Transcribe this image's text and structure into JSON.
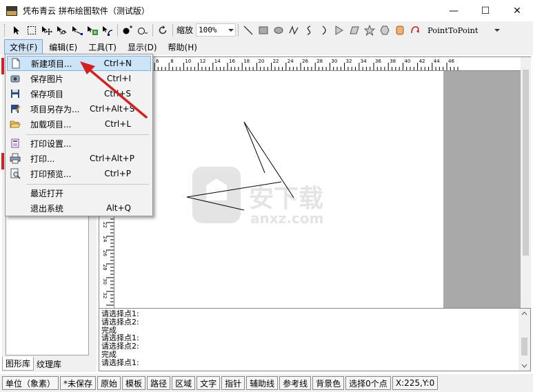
{
  "window": {
    "title": "凭布青云 拼布绘图软件（测试版）",
    "minimize": "—",
    "maximize": "☐",
    "close": "✕"
  },
  "toolbar": {
    "zoom_label": "缩放",
    "zoom_value": "100%",
    "shape_value": "PointToPoint"
  },
  "menubar": {
    "items": [
      "文件(F)",
      "编辑(E)",
      "工具(T)",
      "显示(D)",
      "帮助(H)"
    ],
    "active": "文件(F)"
  },
  "file_menu": {
    "items": [
      {
        "label": "新建项目...",
        "shortcut": "Ctrl+N",
        "icon": "new-file-icon"
      },
      {
        "label": "保存图片",
        "shortcut": "Ctrl+I",
        "icon": "save-image-icon"
      },
      {
        "label": "保存项目",
        "shortcut": "Ctrl+S",
        "icon": "floppy-icon"
      },
      {
        "label": "项目另存为...",
        "shortcut": "Ctrl+Alt+S",
        "icon": "save-as-icon"
      },
      {
        "label": "加载项目...",
        "shortcut": "Ctrl+L",
        "icon": "folder-open-icon"
      },
      {
        "label": "打印设置...",
        "shortcut": "",
        "icon": "print-setup-icon"
      },
      {
        "label": "打印...",
        "shortcut": "Ctrl+Alt+P",
        "icon": "printer-icon"
      },
      {
        "label": "打印预览...",
        "shortcut": "Ctrl+P",
        "icon": "print-preview-icon"
      },
      {
        "label": "最近打开",
        "shortcut": "",
        "icon": ""
      },
      {
        "label": "退出系统",
        "shortcut": "Alt+Q",
        "icon": ""
      }
    ]
  },
  "left_panel": {
    "tabs": [
      "图形库",
      "纹理库"
    ],
    "selected_tab": "图形库"
  },
  "ruler": {
    "top_labels": [
      "6",
      "8",
      "10",
      "12",
      "14",
      "16",
      "18",
      "20",
      "22",
      "24",
      "26",
      "28",
      "30",
      "32",
      "34",
      "36",
      "38",
      "40",
      "42",
      "44",
      "46"
    ],
    "left_labels": [
      "22",
      "24",
      "26",
      "28",
      "30",
      "32"
    ]
  },
  "log": {
    "lines": [
      "请选择点1:",
      "请选择点2:",
      "完成",
      "请选择点1:",
      "请选择点2:",
      "完成",
      "请选择点1:"
    ]
  },
  "statusbar": {
    "cells": [
      "单位（象素）",
      "*未保存",
      "原始",
      "模板",
      "路径",
      "区域",
      "文字",
      "指针",
      "辅助线",
      "参考线",
      "背景色",
      "选择0个点",
      "X:225,Y:0"
    ]
  },
  "watermark": {
    "text_cn": "安下载",
    "text_url": "anxz.com"
  },
  "colors": {
    "accent_arrow": "#d42020",
    "highlight": "#cce4f7",
    "canvas_gray": "#a9a9a9"
  }
}
